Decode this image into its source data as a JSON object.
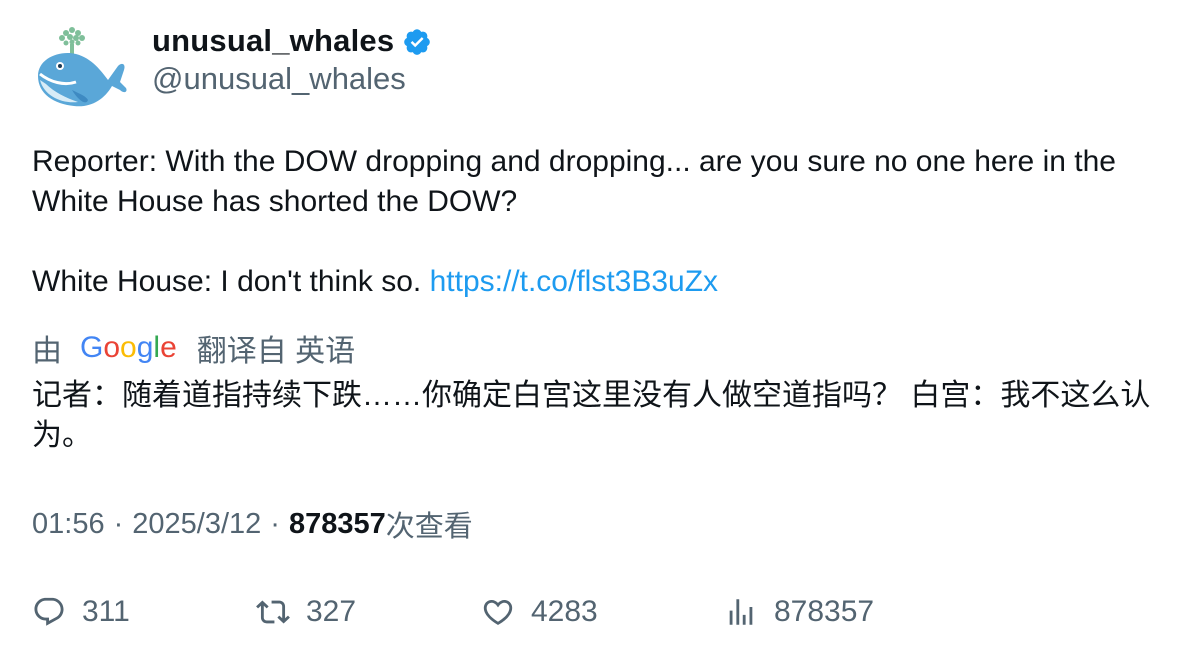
{
  "author": {
    "display_name": "unusual_whales",
    "handle": "@unusual_whales",
    "verified": true,
    "avatar": "whale-logo"
  },
  "tweet": {
    "line1": "Reporter: With the DOW dropping and dropping... are you sure no one here in the White House has shorted the DOW?",
    "line2_prefix": "White House: I don't think so. ",
    "link": "https://t.co/flst3B3uZx"
  },
  "translation": {
    "prefix": "由",
    "provider": "Google",
    "suffix": "翻译自 英语",
    "text": "记者：随着道指持续下跌……你确定白宫这里没有人做空道指吗？ 白宫：我不这么认为。"
  },
  "meta": {
    "time": "01:56",
    "date": "2025/3/12",
    "separator": "·",
    "views_count": "878357",
    "views_label": "次查看"
  },
  "actions": {
    "replies": "311",
    "retweets": "327",
    "likes": "4283",
    "views": "878357"
  },
  "colors": {
    "link": "#1d9bf0",
    "secondary_text": "#536471",
    "verified_badge": "#1d9bf0"
  }
}
